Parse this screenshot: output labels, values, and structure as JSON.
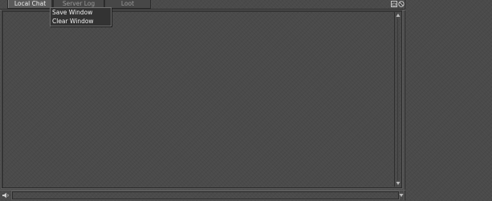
{
  "tabs": [
    {
      "label": "Local Chat",
      "active": true
    },
    {
      "label": "Server Log",
      "active": false
    },
    {
      "label": "Loot",
      "active": false
    }
  ],
  "tab_icons": [
    "folder-icon",
    "block-icon"
  ],
  "context_menu": {
    "items": [
      "Save Window",
      "Clear Window"
    ]
  },
  "chat_log": {
    "lines": []
  },
  "input": {
    "value": "",
    "placeholder": ""
  },
  "icons": {
    "channel": "speaker-icon",
    "scroll_up": "arrow-up-icon",
    "scroll_down": "arrow-down-icon"
  },
  "colors": {
    "background": "#4a4a4a",
    "menu_background": "#333333",
    "text": "#e6e6e6",
    "inactive_text": "#9a9a9a"
  }
}
